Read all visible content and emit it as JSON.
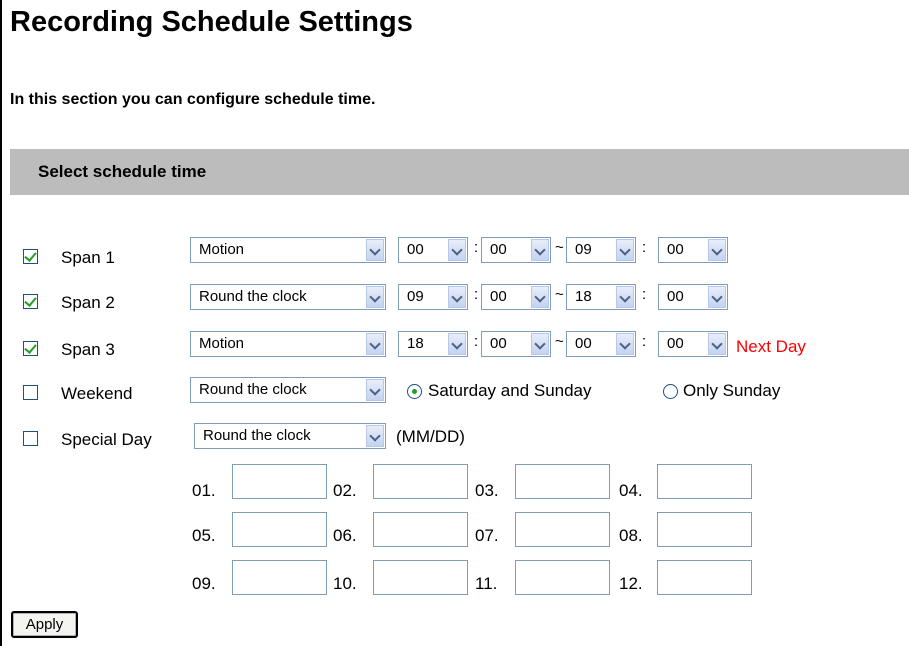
{
  "page": {
    "title": "Recording Schedule Settings",
    "intro": "In this section you can configure schedule time.",
    "section_title": "Select schedule time"
  },
  "spans": [
    {
      "label": "Span 1",
      "checked": true,
      "mode": "Motion",
      "start_hour": "00",
      "start_min": "00",
      "end_hour": "09",
      "end_min": "00"
    },
    {
      "label": "Span 2",
      "checked": true,
      "mode": "Round the clock",
      "start_hour": "09",
      "start_min": "00",
      "end_hour": "18",
      "end_min": "00"
    },
    {
      "label": "Span 3",
      "checked": true,
      "mode": "Motion",
      "start_hour": "18",
      "start_min": "00",
      "end_hour": "00",
      "end_min": "00",
      "note": "Next Day"
    }
  ],
  "separators": {
    "colon": ":",
    "tilde": "~"
  },
  "weekend": {
    "label": "Weekend",
    "checked": false,
    "mode": "Round the clock",
    "options": [
      "Saturday and Sunday",
      "Only Sunday"
    ],
    "selected": "Saturday and Sunday"
  },
  "special_day": {
    "label": "Special Day",
    "checked": false,
    "mode": "Round the clock",
    "format_hint": "(MM/DD)",
    "day_labels": [
      "01.",
      "02.",
      "03.",
      "04.",
      "05.",
      "06.",
      "07.",
      "08.",
      "09.",
      "10.",
      "11.",
      "12."
    ],
    "day_values": [
      "",
      "",
      "",
      "",
      "",
      "",
      "",
      "",
      "",
      "",
      "",
      ""
    ]
  },
  "apply_label": "Apply",
  "colors": {
    "accent": "#21a121",
    "next_day": "#ff0000",
    "header_bg": "#bcbcbc",
    "field_border": "#7f9db9"
  }
}
